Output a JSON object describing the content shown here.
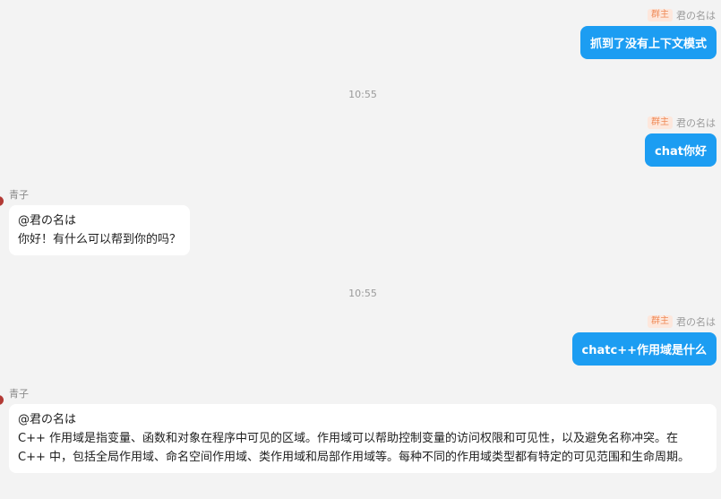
{
  "messages": {
    "m1": {
      "badge": "群主",
      "sender": "君の名は",
      "text": "抓到了没有上下文模式"
    },
    "t1": "10:55",
    "m2": {
      "badge": "群主",
      "sender": "君の名は",
      "text": "chat你好"
    },
    "r1": {
      "sender": "青子",
      "mention": "@君の名は",
      "text": "你好！有什么可以帮到你的吗？"
    },
    "t2": "10:55",
    "m3": {
      "badge": "群主",
      "sender": "君の名は",
      "text": "chatc++作用域是什么"
    },
    "r2": {
      "sender": "青子",
      "mention": "@君の名は",
      "text": "C++ 作用域是指变量、函数和对象在程序中可见的区域。作用域可以帮助控制变量的访问权限和可见性，以及避免名称冲突。在 C++ 中，包括全局作用域、命名空间作用域、类作用域和局部作用域等。每种不同的作用域类型都有特定的可见范围和生命周期。"
    }
  },
  "colors": {
    "background": "#f3f3f3",
    "outgoing_bubble": "#1c9df2",
    "incoming_bubble": "#ffffff",
    "badge_bg": "#fde7dc",
    "badge_text": "#ef8a57",
    "avatar": "#b23a35"
  }
}
